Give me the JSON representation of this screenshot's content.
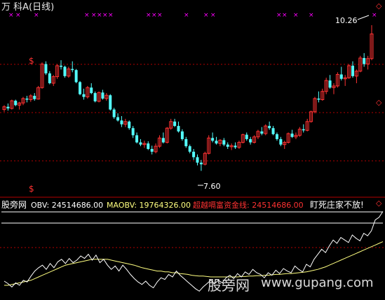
{
  "title": "万 科A(日线)",
  "colors": {
    "up": "#ff3232",
    "down": "#54ffff",
    "magenta": "#ff00ff",
    "grid": "#b40000",
    "obv": "#ffffff",
    "maobv": "#ffff80",
    "red_text": "#ff3232"
  },
  "markers": {
    "high_label": "10.26",
    "low_label": "7.60",
    "dollar": "$",
    "diamond_glyph": "◇"
  },
  "indicator": {
    "name": "股旁网",
    "obv_label": "OBV: 24514686.00",
    "maobv_label": "MAOBV: 19764326.00",
    "line_label": "超越嗝富资金线: 24514686.00",
    "note": "盯死庄家不放!"
  },
  "watermark": {
    "text": "股旁网",
    "url": "www.gupang.com"
  },
  "chart_data": [
    {
      "type": "candlestick",
      "title": "万 科A(日线)",
      "series": [
        {
          "name": "",
          "ohlc": [
            [
              8.72,
              8.8,
              8.68,
              8.77
            ],
            [
              8.77,
              8.83,
              8.7,
              8.74
            ],
            [
              8.74,
              8.9,
              8.72,
              8.88
            ],
            [
              8.88,
              8.9,
              8.78,
              8.8
            ],
            [
              8.8,
              8.86,
              8.72,
              8.84
            ],
            [
              8.84,
              8.95,
              8.8,
              8.92
            ],
            [
              8.92,
              8.97,
              8.85,
              8.9
            ],
            [
              8.9,
              9.0,
              8.86,
              8.97
            ],
            [
              8.97,
              9.02,
              8.88,
              8.91
            ],
            [
              8.91,
              9.15,
              8.9,
              9.12
            ],
            [
              9.12,
              9.58,
              9.1,
              9.55
            ],
            [
              9.55,
              9.6,
              9.35,
              9.38
            ],
            [
              9.38,
              9.42,
              9.18,
              9.2
            ],
            [
              9.2,
              9.35,
              9.15,
              9.32
            ],
            [
              9.32,
              9.55,
              9.28,
              9.52
            ],
            [
              9.52,
              9.62,
              9.45,
              9.5
            ],
            [
              9.5,
              9.52,
              9.3,
              9.33
            ],
            [
              9.33,
              9.5,
              9.3,
              9.46
            ],
            [
              9.46,
              9.6,
              9.4,
              9.44
            ],
            [
              9.44,
              9.46,
              9.2,
              9.22
            ],
            [
              9.22,
              9.24,
              8.98,
              9.0
            ],
            [
              9.0,
              9.1,
              8.9,
              8.95
            ],
            [
              8.95,
              9.15,
              8.92,
              9.12
            ],
            [
              9.12,
              9.2,
              9.0,
              9.02
            ],
            [
              9.02,
              9.05,
              8.85,
              8.87
            ],
            [
              8.87,
              9.05,
              8.85,
              9.03
            ],
            [
              9.03,
              9.08,
              8.9,
              8.92
            ],
            [
              8.92,
              9.02,
              8.88,
              8.98
            ],
            [
              8.98,
              9.0,
              8.7,
              8.72
            ],
            [
              8.72,
              8.75,
              8.55,
              8.58
            ],
            [
              8.58,
              8.65,
              8.5,
              8.52
            ],
            [
              8.52,
              8.6,
              8.4,
              8.45
            ],
            [
              8.45,
              8.55,
              8.4,
              8.5
            ],
            [
              8.5,
              8.52,
              8.35,
              8.38
            ],
            [
              8.38,
              8.42,
              8.2,
              8.25
            ],
            [
              8.25,
              8.3,
              8.1,
              8.12
            ],
            [
              8.12,
              8.18,
              8.05,
              8.08
            ],
            [
              8.08,
              8.15,
              8.02,
              8.1
            ],
            [
              8.1,
              8.14,
              7.98,
              8.0
            ],
            [
              8.0,
              8.06,
              7.9,
              7.95
            ],
            [
              7.95,
              8.1,
              7.92,
              8.05
            ],
            [
              8.05,
              8.25,
              8.02,
              8.2
            ],
            [
              8.2,
              8.3,
              8.1,
              8.12
            ],
            [
              8.12,
              8.4,
              8.1,
              8.38
            ],
            [
              8.38,
              8.55,
              8.35,
              8.5
            ],
            [
              8.5,
              8.55,
              8.4,
              8.42
            ],
            [
              8.42,
              8.5,
              8.3,
              8.32
            ],
            [
              8.32,
              8.36,
              8.15,
              8.18
            ],
            [
              8.18,
              8.22,
              8.02,
              8.05
            ],
            [
              8.05,
              8.08,
              7.92,
              7.95
            ],
            [
              7.95,
              8.0,
              7.8,
              7.85
            ],
            [
              7.85,
              7.9,
              7.7,
              7.75
            ],
            [
              7.75,
              7.8,
              7.6,
              7.72
            ],
            [
              7.72,
              7.95,
              7.7,
              7.92
            ],
            [
              7.92,
              8.25,
              7.9,
              8.2
            ],
            [
              8.2,
              8.3,
              8.12,
              8.15
            ],
            [
              8.15,
              8.22,
              8.08,
              8.1
            ],
            [
              8.1,
              8.18,
              8.05,
              8.16
            ],
            [
              8.16,
              8.2,
              8.05,
              8.08
            ],
            [
              8.08,
              8.12,
              8.0,
              8.04
            ],
            [
              8.04,
              8.1,
              7.98,
              8.06
            ],
            [
              8.06,
              8.12,
              8.0,
              8.03
            ],
            [
              8.03,
              8.15,
              8.0,
              8.12
            ],
            [
              8.12,
              8.28,
              8.1,
              8.26
            ],
            [
              8.26,
              8.3,
              8.15,
              8.18
            ],
            [
              8.18,
              8.22,
              8.08,
              8.12
            ],
            [
              8.12,
              8.25,
              8.1,
              8.22
            ],
            [
              8.22,
              8.35,
              8.18,
              8.32
            ],
            [
              8.32,
              8.4,
              8.25,
              8.28
            ],
            [
              8.28,
              8.45,
              8.25,
              8.42
            ],
            [
              8.42,
              8.5,
              8.35,
              8.38
            ],
            [
              8.38,
              8.42,
              8.25,
              8.27
            ],
            [
              8.27,
              8.3,
              8.15,
              8.18
            ],
            [
              8.18,
              8.22,
              8.05,
              8.08
            ],
            [
              8.08,
              8.15,
              8.0,
              8.12
            ],
            [
              8.12,
              8.3,
              8.1,
              8.28
            ],
            [
              8.28,
              8.35,
              8.2,
              8.22
            ],
            [
              8.22,
              8.3,
              8.18,
              8.25
            ],
            [
              8.25,
              8.4,
              8.22,
              8.36
            ],
            [
              8.36,
              8.45,
              8.3,
              8.34
            ],
            [
              8.34,
              8.55,
              8.32,
              8.5
            ],
            [
              8.5,
              8.7,
              8.48,
              8.68
            ],
            [
              8.68,
              8.95,
              8.65,
              8.92
            ],
            [
              8.92,
              9.05,
              8.85,
              8.9
            ],
            [
              8.9,
              9.1,
              8.88,
              9.05
            ],
            [
              9.05,
              9.3,
              9.0,
              9.25
            ],
            [
              9.25,
              9.35,
              9.1,
              9.12
            ],
            [
              9.12,
              9.2,
              9.0,
              9.15
            ],
            [
              9.15,
              9.4,
              9.12,
              9.36
            ],
            [
              9.36,
              9.5,
              9.25,
              9.28
            ],
            [
              9.28,
              9.35,
              9.15,
              9.3
            ],
            [
              9.3,
              9.55,
              9.28,
              9.52
            ],
            [
              9.52,
              9.6,
              9.3,
              9.33
            ],
            [
              9.33,
              9.45,
              9.2,
              9.42
            ],
            [
              9.42,
              9.7,
              9.4,
              9.66
            ],
            [
              9.66,
              9.75,
              9.5,
              9.55
            ],
            [
              9.55,
              9.7,
              9.45,
              9.65
            ],
            [
              9.65,
              10.26,
              9.62,
              10.1
            ]
          ]
        }
      ],
      "annotations": [
        "10.26",
        "7.60"
      ]
    },
    {
      "type": "line",
      "title": "股旁网",
      "series": [
        {
          "name": "OBV",
          "values": [
            20,
            14,
            6,
            16,
            10,
            22,
            18,
            32,
            44,
            52,
            58,
            48,
            62,
            52,
            66,
            72,
            62,
            74,
            64,
            70,
            80,
            74,
            84,
            70,
            82,
            64,
            72,
            58,
            48,
            56,
            44,
            58,
            48,
            36,
            26,
            18,
            12,
            20,
            10,
            4,
            18,
            28,
            24,
            36,
            30,
            44,
            34,
            26,
            18,
            10,
            2,
            -4,
            6,
            14,
            22,
            14,
            22,
            16,
            28,
            34,
            26,
            38,
            30,
            42,
            36,
            48,
            40,
            36,
            28,
            40,
            34,
            46,
            38,
            50,
            44,
            40,
            56,
            48,
            42,
            60,
            54,
            72,
            84,
            96,
            88,
            104,
            118,
            110,
            124,
            118,
            112,
            130,
            122,
            116,
            134,
            128,
            140,
            166,
            172,
            186
          ]
        },
        {
          "name": "MAOBV",
          "values": [
            10,
            10,
            12,
            14,
            16,
            18,
            20,
            22,
            26,
            30,
            34,
            38,
            42,
            46,
            50,
            54,
            58,
            60,
            62,
            64,
            66,
            68,
            70,
            72,
            72,
            72,
            72,
            72,
            70,
            68,
            66,
            64,
            62,
            60,
            58,
            55,
            52,
            50,
            48,
            46,
            44,
            44,
            42,
            42,
            40,
            40,
            38,
            37,
            36,
            34,
            33,
            32,
            32,
            31,
            30,
            30,
            30,
            30,
            30,
            30,
            30,
            30,
            31,
            31,
            32,
            32,
            33,
            33,
            34,
            34,
            35,
            36,
            36,
            37,
            38,
            38,
            39,
            40,
            41,
            42,
            44,
            46,
            48,
            51,
            54,
            58,
            62,
            66,
            70,
            74,
            78,
            82,
            86,
            90,
            94,
            98,
            102,
            106,
            110,
            114
          ]
        }
      ]
    }
  ]
}
